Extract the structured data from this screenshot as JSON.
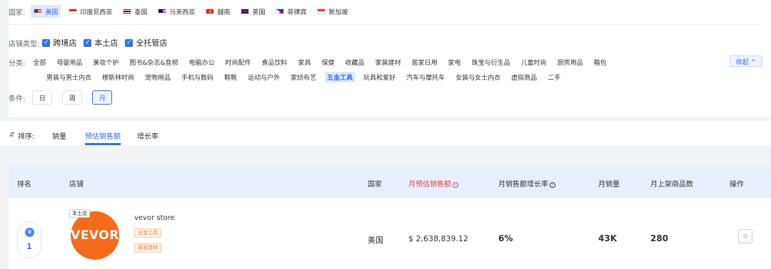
{
  "filters": {
    "country_label": "国家:",
    "countries": [
      {
        "label": "美国",
        "active": true,
        "flag": "us-flag"
      },
      {
        "label": "印度尼西亚",
        "active": false,
        "flag": "indonesia-flag"
      },
      {
        "label": "泰国",
        "active": false,
        "flag": "thailand-flag"
      },
      {
        "label": "马来西亚",
        "active": false,
        "flag": "malaysia-flag"
      },
      {
        "label": "越南",
        "active": false,
        "flag": "vietnam-flag"
      },
      {
        "label": "英国",
        "active": false,
        "flag": "uk-flag"
      },
      {
        "label": "菲律宾",
        "active": false,
        "flag": "philippines-flag"
      },
      {
        "label": "新加坡",
        "active": false,
        "flag": "singapore-flag"
      }
    ],
    "store_type_label": "店铺类型:",
    "store_types": [
      {
        "label": "跨境店",
        "checked": true
      },
      {
        "label": "本土店",
        "checked": true
      },
      {
        "label": "全托管店",
        "checked": true
      }
    ],
    "category_label": "分类:",
    "categories_row1": [
      "全部",
      "母婴用品",
      "美妆个护",
      "图书&杂志&音频",
      "电脑办公",
      "时尚配件",
      "食品饮料",
      "家具",
      "保健",
      "收藏品",
      "家装建材",
      "居家日用",
      "家电",
      "珠宝与衍生品",
      "儿童时尚",
      "厨房用品",
      "箱包"
    ],
    "categories_row2": [
      "男装与男士内衣",
      "穆斯林时尚",
      "宠物用品",
      "手机与数码",
      "鞋靴",
      "运动与户外",
      "家纺布艺",
      "五金工具",
      "玩具和爱好",
      "汽车与摩托车",
      "女装与女士内衣",
      "虚拟商品",
      "二手"
    ],
    "active_category": "五金工具",
    "collapse_label": "收起 ^",
    "condition_label": "条件:",
    "conditions": [
      {
        "label": "日",
        "active": false
      },
      {
        "label": "周",
        "active": false
      },
      {
        "label": "月",
        "active": true
      }
    ]
  },
  "sort": {
    "label": "排序:",
    "tabs": [
      {
        "label": "销量",
        "active": false
      },
      {
        "label": "预估销售额",
        "active": true
      },
      {
        "label": "增长率",
        "active": false
      }
    ]
  },
  "table": {
    "headers": {
      "rank": "排名",
      "store": "店铺",
      "country": "国家",
      "monthly_sales_amount": "月预估销售额",
      "growth_rate": "月销售额增长率",
      "monthly_sales": "月销量",
      "listed_products": "月上架商品数",
      "action": "操作"
    },
    "rows": [
      {
        "rank": "1",
        "store_tag": "本土店",
        "logo_text": "VEVOR",
        "store_name": "vevor store",
        "tags": [
          "五金工具",
          "家装建材"
        ],
        "country": "美国",
        "sales_amount": "$ 2,638,839.12",
        "growth_rate": "6%",
        "monthly_sales": "43K",
        "listed_products": "280"
      }
    ]
  },
  "colors": {
    "accent": "#3370e8",
    "highlight": "#e8424b",
    "logo": "#f46b1c",
    "tag": "#f28437"
  }
}
